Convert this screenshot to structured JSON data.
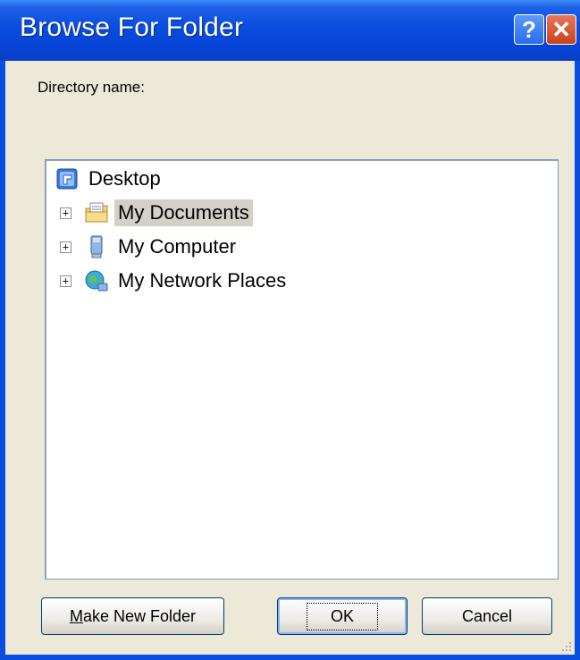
{
  "window": {
    "title": "Browse For Folder",
    "help_label": "?",
    "close_label": "✕"
  },
  "directory_label": "Directory name:",
  "tree": {
    "root": {
      "label": "Desktop",
      "icon": "desktop-icon"
    },
    "items": [
      {
        "label": "My Documents",
        "icon": "my-documents-icon",
        "expander": "+",
        "selected": true
      },
      {
        "label": "My Computer",
        "icon": "my-computer-icon",
        "expander": "+",
        "selected": false
      },
      {
        "label": "My Network Places",
        "icon": "my-network-places-icon",
        "expander": "+",
        "selected": false
      }
    ]
  },
  "buttons": {
    "make_new_folder_prefix": "M",
    "make_new_folder_rest": "ake New Folder",
    "ok": "OK",
    "cancel": "Cancel"
  }
}
